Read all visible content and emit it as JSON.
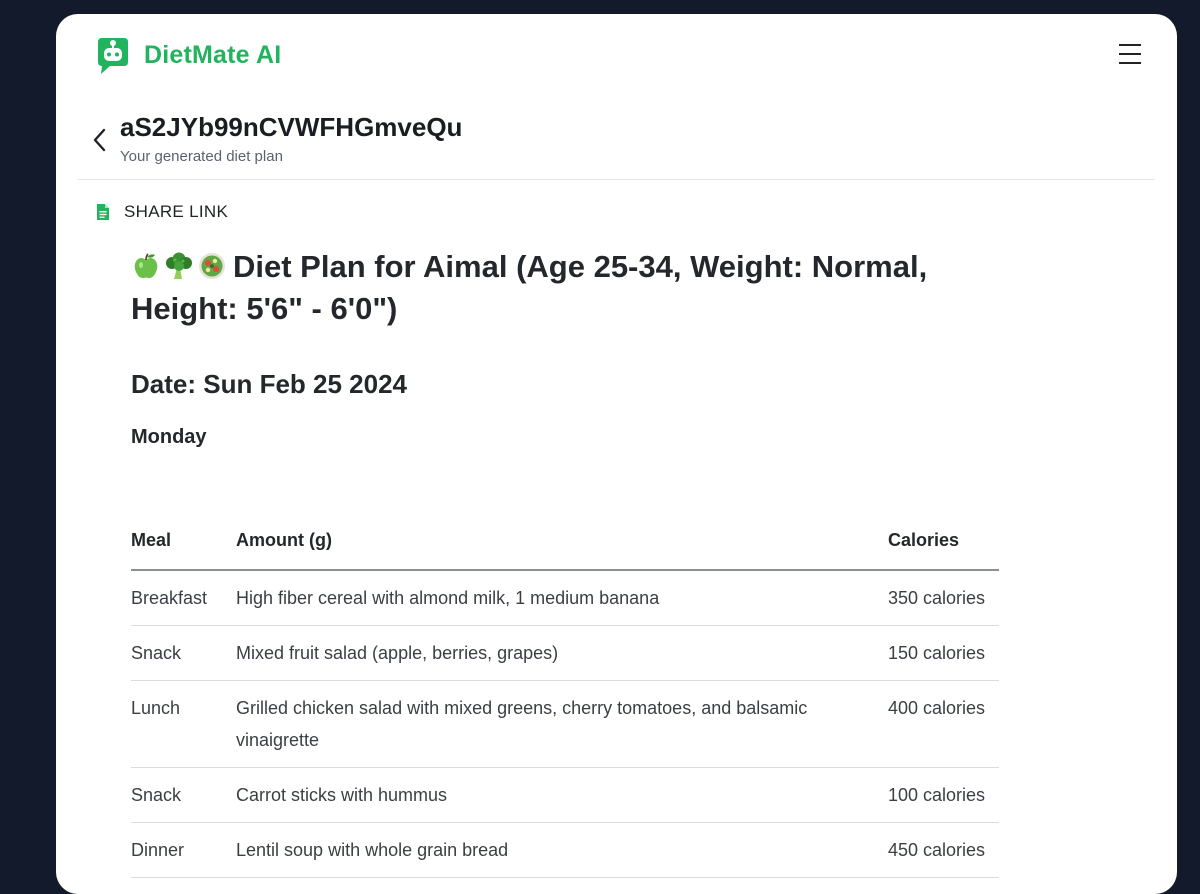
{
  "app": {
    "name": "DietMate AI",
    "brand_color": "#22b35e"
  },
  "header": {
    "plan_id": "aS2JYb99nCVWFHGmveQu",
    "subtitle": "Your generated diet plan"
  },
  "share": {
    "label": "SHARE LINK",
    "icon": "document-icon"
  },
  "plan": {
    "emojis": [
      "green-apple-icon",
      "broccoli-icon",
      "salad-icon"
    ],
    "title": "Diet Plan for Aimal (Age 25-34, Weight: Normal, Height: 5'6\" - 6'0\")",
    "date": "Date: Sun Feb 25 2024",
    "day": "Monday"
  },
  "table": {
    "headers": [
      "Meal",
      "Amount (g)",
      "Calories"
    ],
    "rows": [
      {
        "meal": "Breakfast",
        "amount": "High fiber cereal with almond milk, 1 medium banana",
        "calories": "350 calories"
      },
      {
        "meal": "Snack",
        "amount": "Mixed fruit salad (apple, berries, grapes)",
        "calories": "150 calories"
      },
      {
        "meal": "Lunch",
        "amount": "Grilled chicken salad with mixed greens, cherry tomatoes, and balsamic vinaigrette",
        "calories": "400 calories"
      },
      {
        "meal": "Snack",
        "amount": "Carrot sticks with hummus",
        "calories": "100 calories"
      },
      {
        "meal": "Dinner",
        "amount": "Lentil soup with whole grain bread",
        "calories": "450 calories"
      }
    ]
  }
}
